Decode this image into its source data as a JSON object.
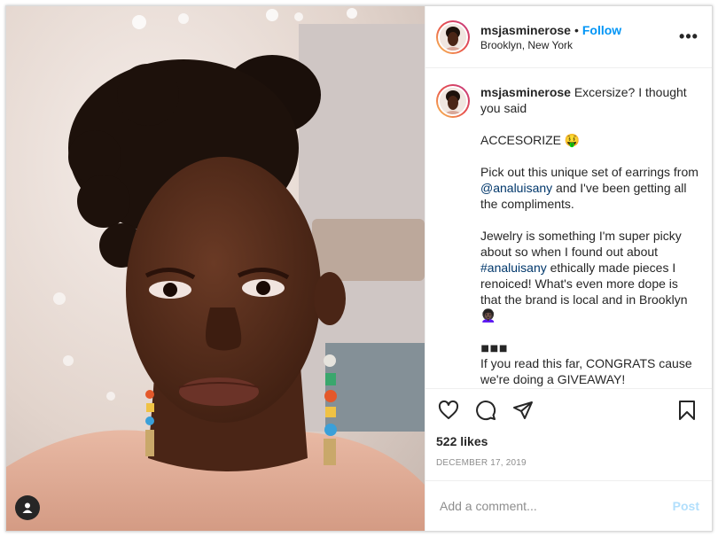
{
  "post": {
    "username": "msjasminerose",
    "separator": "•",
    "follow_label": "Follow",
    "location": "Brooklyn, New York",
    "more_label": "•••"
  },
  "caption": {
    "username": "msjasminerose",
    "line1": "Excersize? I thought you said",
    "line2": "ACCESORIZE 🤑",
    "line3_a": "Pick out this unique set of earrings from ",
    "line3_mention": "@analuisany",
    "line3_b": " and I've been getting all the compliments.",
    "line4_a": "Jewelry is something I'm super picky about so when I found out about ",
    "line4_hashtag": "#analuisany",
    "line4_b": " ethically made pieces I renoiced! What's even more dope is that the brand is local and in Brooklyn 👩🏿‍🦱",
    "line5": "◾◾◾",
    "line6": "If you read this far, CONGRATS cause we're doing a GIVEAWAY!"
  },
  "actions": {
    "like_icon": "heart-icon",
    "comment_icon": "comment-icon",
    "share_icon": "share-icon",
    "save_icon": "bookmark-icon"
  },
  "likes": "522 likes",
  "date": "DECEMBER 17, 2019",
  "comment_box": {
    "placeholder": "Add a comment...",
    "post_label": "Post"
  },
  "colors": {
    "accent": "#0095f6",
    "link": "#00376b",
    "post_disabled": "#b2dffc"
  }
}
